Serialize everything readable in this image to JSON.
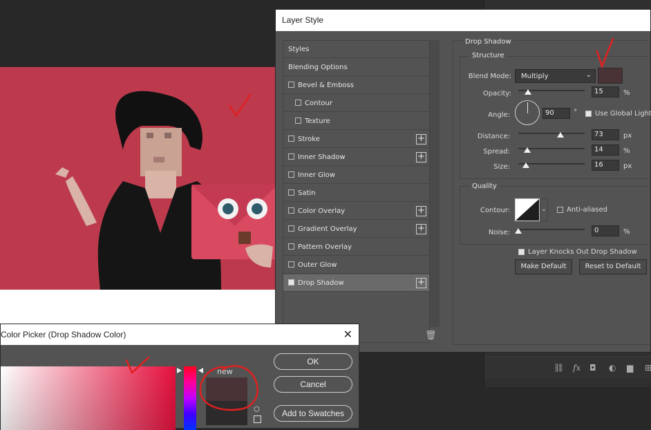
{
  "background_panel": {
    "icons": [
      "link-icon",
      "fx-icon",
      "mask-icon",
      "adjustment-icon",
      "folder-icon",
      "new-layer-icon"
    ],
    "fx_label": "fx"
  },
  "layer_style": {
    "title": "Layer Style",
    "items": [
      {
        "label": "Styles",
        "check": false,
        "plus": false,
        "indent": false,
        "active": false
      },
      {
        "label": "Blending Options",
        "check": false,
        "plus": false,
        "indent": false,
        "active": false
      },
      {
        "label": "Bevel & Emboss",
        "check": true,
        "checked": false,
        "plus": false,
        "indent": false,
        "active": false
      },
      {
        "label": "Contour",
        "check": true,
        "checked": false,
        "plus": false,
        "indent": true,
        "active": false
      },
      {
        "label": "Texture",
        "check": true,
        "checked": false,
        "plus": false,
        "indent": true,
        "active": false
      },
      {
        "label": "Stroke",
        "check": true,
        "checked": false,
        "plus": true,
        "indent": false,
        "active": false
      },
      {
        "label": "Inner Shadow",
        "check": true,
        "checked": false,
        "plus": true,
        "indent": false,
        "active": false
      },
      {
        "label": "Inner Glow",
        "check": true,
        "checked": false,
        "plus": false,
        "indent": false,
        "active": false
      },
      {
        "label": "Satin",
        "check": true,
        "checked": false,
        "plus": false,
        "indent": false,
        "active": false
      },
      {
        "label": "Color Overlay",
        "check": true,
        "checked": false,
        "plus": true,
        "indent": false,
        "active": false
      },
      {
        "label": "Gradient Overlay",
        "check": true,
        "checked": false,
        "plus": true,
        "indent": false,
        "active": false
      },
      {
        "label": "Pattern Overlay",
        "check": true,
        "checked": false,
        "plus": false,
        "indent": false,
        "active": false
      },
      {
        "label": "Outer Glow",
        "check": true,
        "checked": false,
        "plus": false,
        "indent": false,
        "active": false
      },
      {
        "label": "Drop Shadow",
        "check": true,
        "checked": true,
        "plus": true,
        "indent": false,
        "active": true
      }
    ],
    "drop_shadow": {
      "section_title": "Drop Shadow",
      "structure_title": "Structure",
      "blend_mode_label": "Blend Mode:",
      "blend_mode_value": "Multiply",
      "shadow_color": "#4a3337",
      "opacity_label": "Opacity:",
      "opacity_value": "15",
      "opacity_unit": "%",
      "angle_label": "Angle:",
      "angle_value": "90",
      "angle_unit": "°",
      "global_light_label": "Use Global Light",
      "global_light_checked": true,
      "distance_label": "Distance:",
      "distance_value": "73",
      "distance_unit": "px",
      "spread_label": "Spread:",
      "spread_value": "14",
      "spread_unit": "%",
      "size_label": "Size:",
      "size_value": "16",
      "size_unit": "px",
      "quality_title": "Quality",
      "contour_label": "Contour:",
      "anti_aliased_label": "Anti-aliased",
      "anti_aliased_checked": false,
      "noise_label": "Noise:",
      "noise_value": "0",
      "noise_unit": "%",
      "knockout_label": "Layer Knocks Out Drop Shadow",
      "knockout_checked": true,
      "make_default": "Make Default",
      "reset_default": "Reset to Default"
    }
  },
  "color_picker": {
    "title": "Color Picker (Drop Shadow Color)",
    "new_label": "new",
    "ok": "OK",
    "cancel": "Cancel",
    "add_to_swatches": "Add to Swatches",
    "new_color": "#4a3337",
    "current_color": "#2c2a2b"
  }
}
